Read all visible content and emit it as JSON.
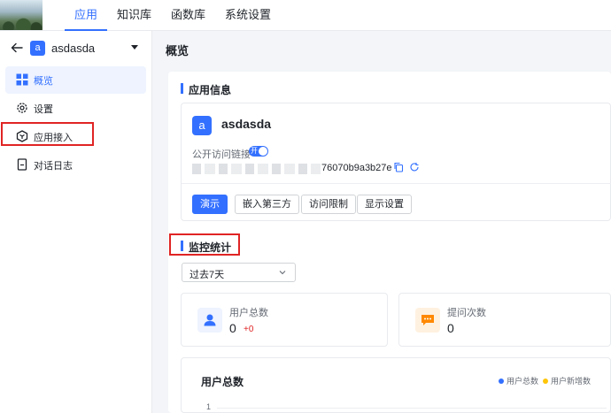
{
  "nav": {
    "items": [
      {
        "label": "应用",
        "active": true
      },
      {
        "label": "知识库",
        "active": false
      },
      {
        "label": "函数库",
        "active": false
      },
      {
        "label": "系统设置",
        "active": false
      }
    ]
  },
  "sidebar": {
    "app_avatar": "a",
    "app_name": "asdasda",
    "items": [
      {
        "label": "概览",
        "icon": "grid-icon",
        "active": true
      },
      {
        "label": "设置",
        "icon": "gear-icon",
        "active": false
      },
      {
        "label": "应用接入",
        "icon": "hexagon-icon",
        "active": false
      },
      {
        "label": "对话日志",
        "icon": "document-icon",
        "active": false
      }
    ]
  },
  "main": {
    "page_title": "概览",
    "app_info": {
      "section_title": "应用信息",
      "avatar": "a",
      "name": "asdasda",
      "public_access_label": "公开访问链接",
      "toggle_label": "开",
      "toggle_on": true,
      "link_visible_suffix": "76070b9a3b27e",
      "buttons": [
        "演示",
        "嵌入第三方",
        "访问限制",
        "显示设置"
      ]
    },
    "monitor": {
      "section_title": "监控统计",
      "range_select": "过去7天",
      "stats": [
        {
          "label": "用户总数",
          "value": "0",
          "delta": "+0",
          "icon": "user-icon"
        },
        {
          "label": "提问次数",
          "value": "0",
          "icon": "chat-bubble-icon"
        }
      ],
      "chart": {
        "title": "用户总数",
        "legend": [
          {
            "name": "用户总数",
            "color": "#3370ff"
          },
          {
            "name": "用户新增数",
            "color": "#ffc60a"
          }
        ],
        "y_tick": "1"
      }
    }
  },
  "colors": {
    "accent": "#3370ff",
    "highlight_box": "#e02424",
    "orange_icon_bg": "#fff1e0",
    "blue_icon_bg": "#eef3ff"
  }
}
